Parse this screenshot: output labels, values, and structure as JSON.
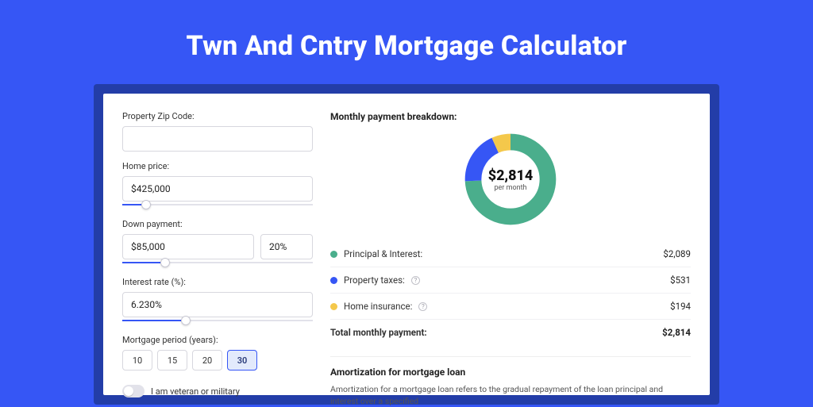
{
  "title": "Twn And Cntry Mortgage Calculator",
  "form": {
    "zip_label": "Property Zip Code:",
    "zip_value": "",
    "home_price_label": "Home price:",
    "home_price_value": "$425,000",
    "down_payment_label": "Down payment:",
    "down_payment_value": "$85,000",
    "down_payment_pct": "20%",
    "interest_label": "Interest rate (%):",
    "interest_value": "6.230%",
    "period_label": "Mortgage period (years):",
    "periods": [
      "10",
      "15",
      "20",
      "30"
    ],
    "period_active_index": 3,
    "veteran_label": "I am veteran or military"
  },
  "breakdown": {
    "heading": "Monthly payment breakdown:",
    "center_value": "$2,814",
    "center_sub": "per month",
    "items": [
      {
        "label": "Principal & Interest:",
        "value": "$2,089",
        "color": "#4aae8c",
        "info": false
      },
      {
        "label": "Property taxes:",
        "value": "$531",
        "color": "#3656f5",
        "info": true
      },
      {
        "label": "Home insurance:",
        "value": "$194",
        "color": "#f4c84b",
        "info": true
      }
    ],
    "total_label": "Total monthly payment:",
    "total_value": "$2,814"
  },
  "amort": {
    "heading": "Amortization for mortgage loan",
    "text": "Amortization for a mortgage loan refers to the gradual repayment of the loan principal and interest over a specified"
  },
  "chart_data": {
    "type": "pie",
    "title": "Monthly payment breakdown",
    "categories": [
      "Principal & Interest",
      "Property taxes",
      "Home insurance"
    ],
    "values": [
      2089,
      531,
      194
    ],
    "colors": [
      "#4aae8c",
      "#3656f5",
      "#f4c84b"
    ],
    "total": 2814,
    "unit": "USD per month",
    "donut": true
  }
}
